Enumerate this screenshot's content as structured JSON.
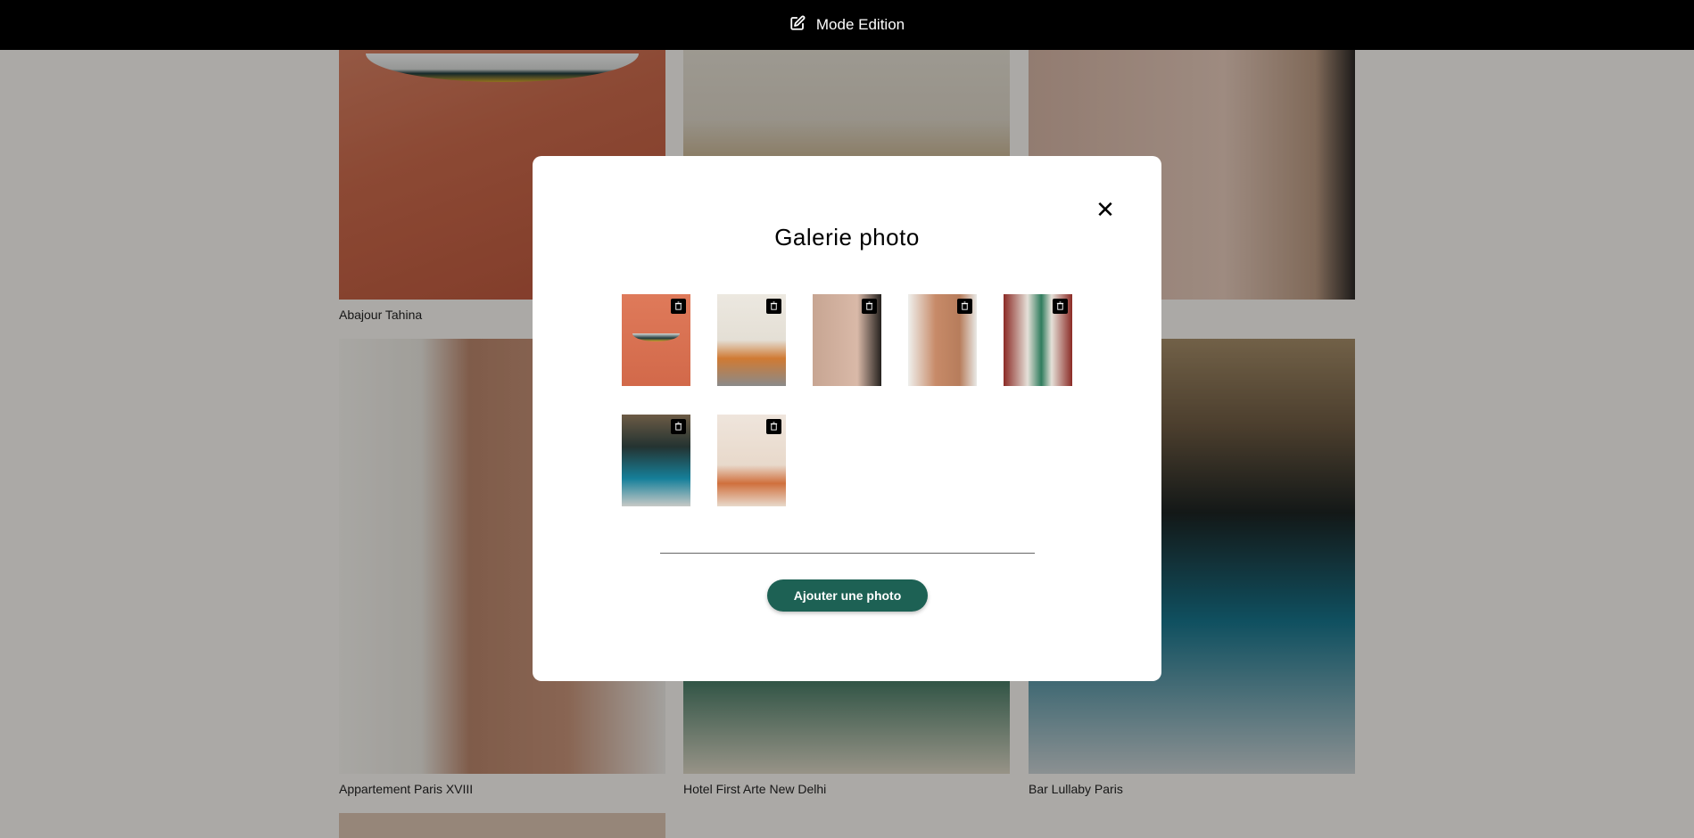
{
  "topbar": {
    "label": "Mode Edition",
    "icon": "edit-icon"
  },
  "gallery": {
    "captions": [
      "Abajour Tahina",
      "",
      "",
      "Appartement Paris XVIII",
      "Hotel First Arte New Delhi",
      "Bar Lullaby Paris"
    ]
  },
  "modal": {
    "title": "Galerie photo",
    "close_label": "✕",
    "add_button_label": "Ajouter une photo",
    "thumbnail_count": 7
  },
  "colors": {
    "accent": "#1d6154",
    "topbar": "#000000",
    "modal_bg": "#ffffff"
  }
}
